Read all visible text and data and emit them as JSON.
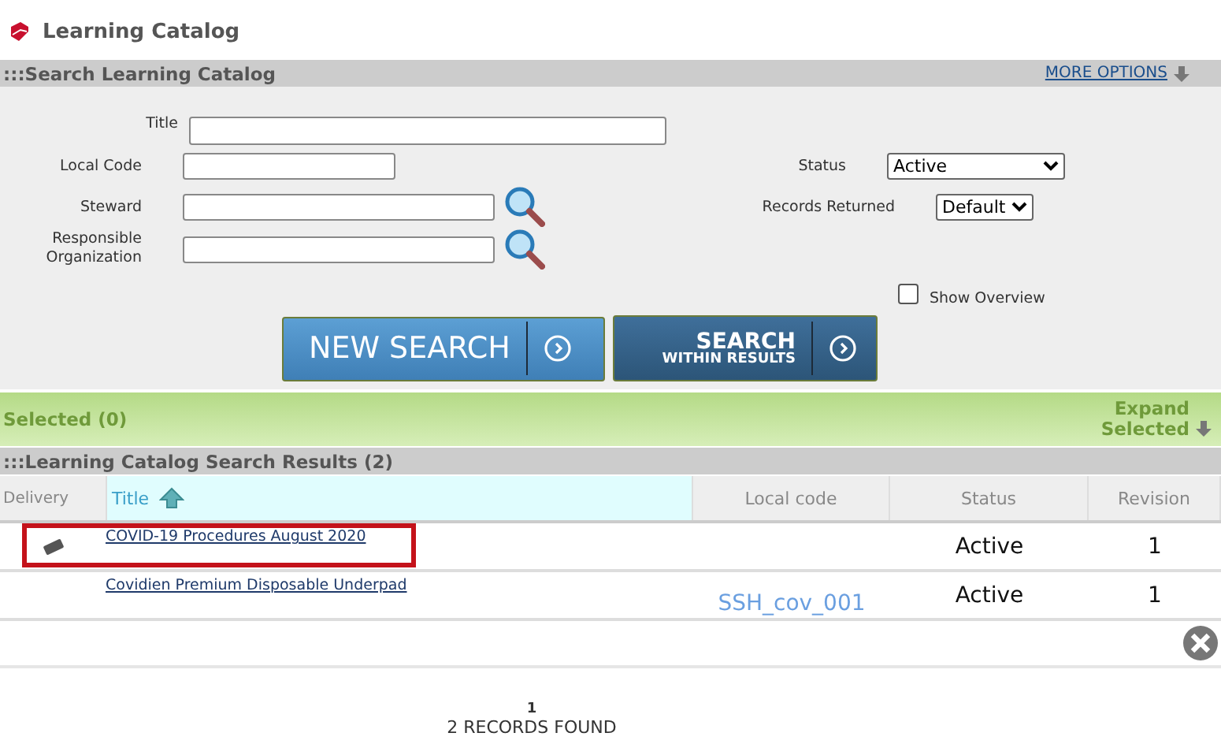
{
  "page": {
    "title": "Learning Catalog"
  },
  "search_panel": {
    "title": ":::Search Learning Catalog",
    "more_options": "MORE OPTIONS",
    "fields": {
      "title": {
        "label": "Title"
      },
      "local_code": {
        "label": "Local Code"
      },
      "steward": {
        "label": "Steward"
      },
      "responsible_organization": {
        "label": "Responsible Organization"
      }
    },
    "status": {
      "label": "Status",
      "value": "Active"
    },
    "records_returned": {
      "label": "Records Returned",
      "value": "Default"
    },
    "show_overview": {
      "label": "Show Overview",
      "checked": false
    },
    "buttons": {
      "new_search": "NEW SEARCH",
      "search_within": {
        "line1": "SEARCH",
        "line2": "WITHIN RESULTS"
      }
    }
  },
  "selected_bar": {
    "label": "Selected (0)",
    "expand": {
      "line1": "Expand",
      "line2": "Selected"
    }
  },
  "results": {
    "title": ":::Learning Catalog Search Results (2)",
    "columns": [
      {
        "label": "Delivery",
        "sorted": false
      },
      {
        "label": "Title",
        "sorted": true
      },
      {
        "label": "Local code",
        "sorted": false
      },
      {
        "label": "Status",
        "sorted": false
      },
      {
        "label": "Revision",
        "sorted": false
      }
    ],
    "rows": [
      {
        "delivery_icon": true,
        "title": "COVID-19 Procedures August 2020",
        "local_code": "",
        "status": "Active",
        "revision": "1",
        "highlighted": true
      },
      {
        "delivery_icon": false,
        "title": "Covidien Premium Disposable Underpad",
        "local_code": "SSH_cov_001",
        "status": "Active",
        "revision": "1",
        "highlighted": false
      }
    ]
  },
  "pagination": {
    "page": "1",
    "summary": "2 RECORDS FOUND"
  }
}
